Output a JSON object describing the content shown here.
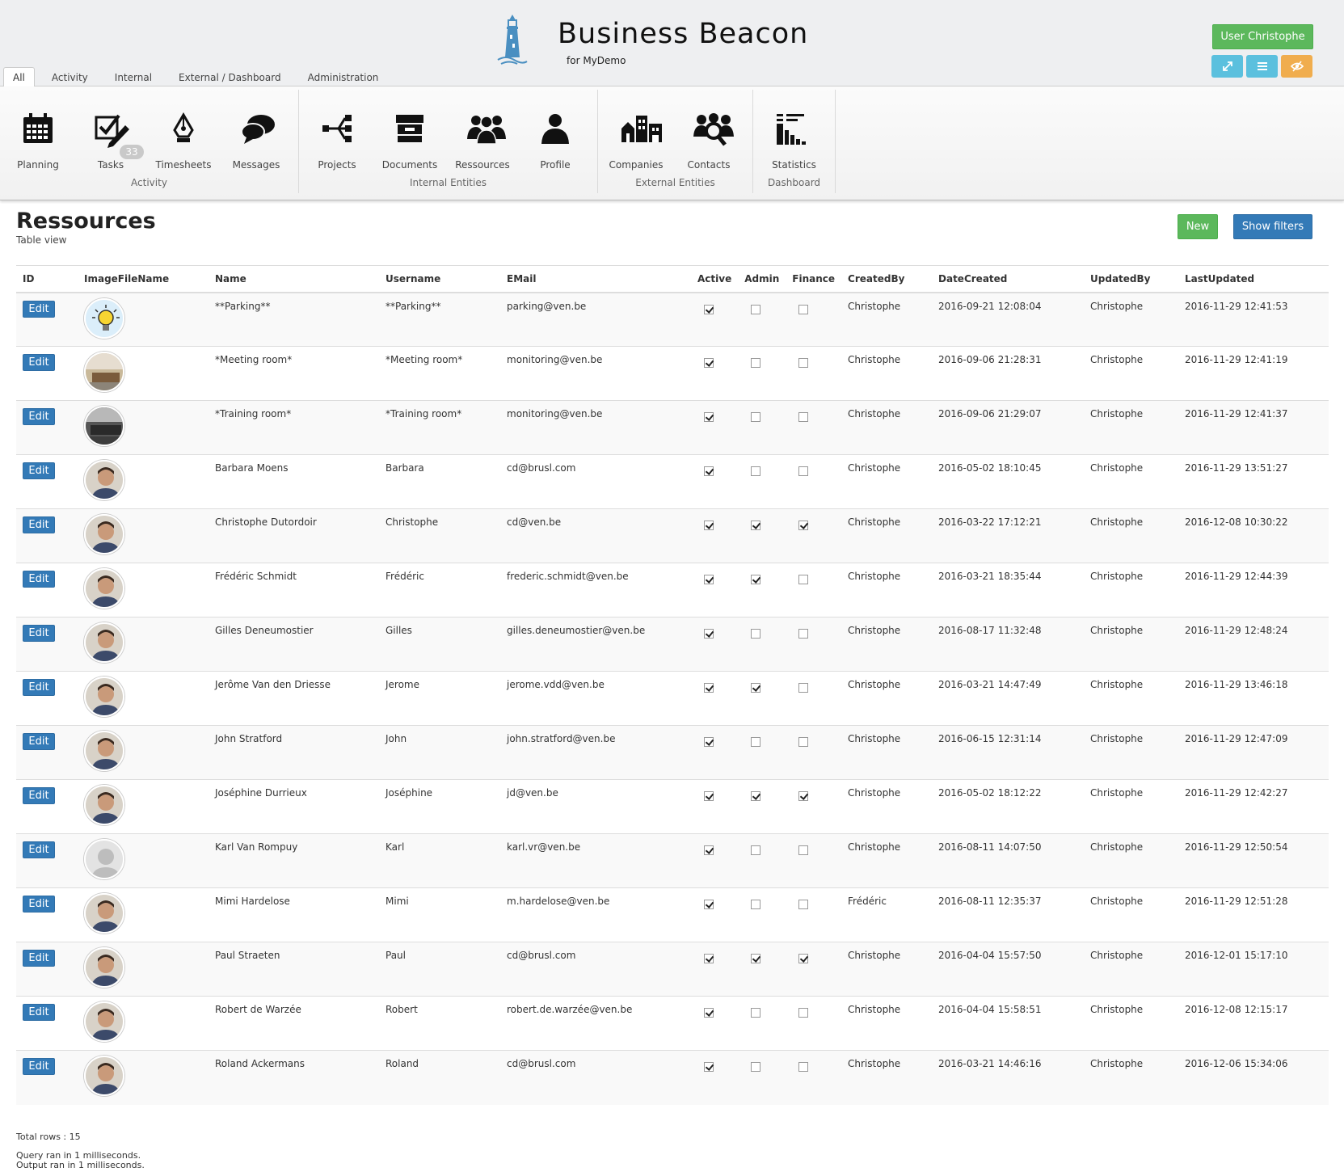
{
  "header": {
    "title": "Business Beacon",
    "subtitle": "for MyDemo",
    "user_button": "User Christophe",
    "tabs": [
      "All",
      "Activity",
      "Internal",
      "External / Dashboard",
      "Administration"
    ]
  },
  "ribbon": {
    "groups": [
      {
        "label": "Activity",
        "items": [
          {
            "label": "Planning",
            "icon": "calendar-icon"
          },
          {
            "label": "Tasks",
            "icon": "tasks-icon",
            "badge": "33"
          },
          {
            "label": "Timesheets",
            "icon": "pen-nib-icon"
          },
          {
            "label": "Messages",
            "icon": "chat-bubbles-icon"
          }
        ]
      },
      {
        "label": "Internal Entities",
        "items": [
          {
            "label": "Projects",
            "icon": "share-tree-icon"
          },
          {
            "label": "Documents",
            "icon": "archive-box-icon"
          },
          {
            "label": "Ressources",
            "icon": "people-group-icon"
          },
          {
            "label": "Profile",
            "icon": "person-icon"
          }
        ]
      },
      {
        "label": "External Entities",
        "items": [
          {
            "label": "Companies",
            "icon": "buildings-icon"
          },
          {
            "label": "Contacts",
            "icon": "people-search-icon"
          }
        ]
      },
      {
        "label": "Dashboard",
        "items": [
          {
            "label": "Statistics",
            "icon": "statistics-icon"
          }
        ]
      }
    ]
  },
  "page": {
    "title": "Ressources",
    "subtitle": "Table view",
    "new_button": "New",
    "filters_button": "Show filters"
  },
  "table": {
    "columns": [
      "ID",
      "ImageFileName",
      "Name",
      "Username",
      "EMail",
      "Active",
      "Admin",
      "Finance",
      "CreatedBy",
      "DateCreated",
      "UpdatedBy",
      "LastUpdated"
    ],
    "edit_label": "Edit",
    "rows": [
      {
        "name": "**Parking**",
        "username": "**Parking**",
        "email": "parking@ven.be",
        "active": true,
        "admin": false,
        "finance": false,
        "created_by": "Christophe",
        "date_created": "2016-09-21 12:08:04",
        "updated_by": "Christophe",
        "last_updated": "2016-11-29 12:41:53",
        "avatar": "lightbulb"
      },
      {
        "name": "*Meeting room*",
        "username": "*Meeting room*",
        "email": "monitoring@ven.be",
        "active": true,
        "admin": false,
        "finance": false,
        "created_by": "Christophe",
        "date_created": "2016-09-06 21:28:31",
        "updated_by": "Christophe",
        "last_updated": "2016-11-29 12:41:19",
        "avatar": "room"
      },
      {
        "name": "*Training room*",
        "username": "*Training room*",
        "email": "monitoring@ven.be",
        "active": true,
        "admin": false,
        "finance": false,
        "created_by": "Christophe",
        "date_created": "2016-09-06 21:29:07",
        "updated_by": "Christophe",
        "last_updated": "2016-11-29 12:41:37",
        "avatar": "room-dark"
      },
      {
        "name": "Barbara Moens",
        "username": "Barbara",
        "email": "cd@brusl.com",
        "active": true,
        "admin": false,
        "finance": false,
        "created_by": "Christophe",
        "date_created": "2016-05-02 18:10:45",
        "updated_by": "Christophe",
        "last_updated": "2016-11-29 13:51:27",
        "avatar": "person"
      },
      {
        "name": "Christophe Dutordoir",
        "username": "Christophe",
        "email": "cd@ven.be",
        "active": true,
        "admin": true,
        "finance": true,
        "created_by": "Christophe",
        "date_created": "2016-03-22 17:12:21",
        "updated_by": "Christophe",
        "last_updated": "2016-12-08 10:30:22",
        "avatar": "person"
      },
      {
        "name": "Frédéric Schmidt",
        "username": "Frédéric",
        "email": "frederic.schmidt@ven.be",
        "active": true,
        "admin": true,
        "finance": false,
        "created_by": "Christophe",
        "date_created": "2016-03-21 18:35:44",
        "updated_by": "Christophe",
        "last_updated": "2016-11-29 12:44:39",
        "avatar": "person"
      },
      {
        "name": "Gilles Deneumostier",
        "username": "Gilles",
        "email": "gilles.deneumostier@ven.be",
        "active": true,
        "admin": false,
        "finance": false,
        "created_by": "Christophe",
        "date_created": "2016-08-17 11:32:48",
        "updated_by": "Christophe",
        "last_updated": "2016-11-29 12:48:24",
        "avatar": "person"
      },
      {
        "name": "Jerôme Van den Driesse",
        "username": "Jerome",
        "email": "jerome.vdd@ven.be",
        "active": true,
        "admin": true,
        "finance": false,
        "created_by": "Christophe",
        "date_created": "2016-03-21 14:47:49",
        "updated_by": "Christophe",
        "last_updated": "2016-11-29 13:46:18",
        "avatar": "person"
      },
      {
        "name": "John Stratford",
        "username": "John",
        "email": "john.stratford@ven.be",
        "active": true,
        "admin": false,
        "finance": false,
        "created_by": "Christophe",
        "date_created": "2016-06-15 12:31:14",
        "updated_by": "Christophe",
        "last_updated": "2016-11-29 12:47:09",
        "avatar": "person"
      },
      {
        "name": "Joséphine Durrieux",
        "username": "Joséphine",
        "email": "jd@ven.be",
        "active": true,
        "admin": true,
        "finance": true,
        "created_by": "Christophe",
        "date_created": "2016-05-02 18:12:22",
        "updated_by": "Christophe",
        "last_updated": "2016-11-29 12:42:27",
        "avatar": "person"
      },
      {
        "name": "Karl Van Rompuy",
        "username": "Karl",
        "email": "karl.vr@ven.be",
        "active": true,
        "admin": false,
        "finance": false,
        "created_by": "Christophe",
        "date_created": "2016-08-11 14:07:50",
        "updated_by": "Christophe",
        "last_updated": "2016-11-29 12:50:54",
        "avatar": "placeholder"
      },
      {
        "name": "Mimi Hardelose",
        "username": "Mimi",
        "email": "m.hardelose@ven.be",
        "active": true,
        "admin": false,
        "finance": false,
        "created_by": "Frédéric",
        "date_created": "2016-08-11 12:35:37",
        "updated_by": "Christophe",
        "last_updated": "2016-11-29 12:51:28",
        "avatar": "person"
      },
      {
        "name": "Paul Straeten",
        "username": "Paul",
        "email": "cd@brusl.com",
        "active": true,
        "admin": true,
        "finance": true,
        "created_by": "Christophe",
        "date_created": "2016-04-04 15:57:50",
        "updated_by": "Christophe",
        "last_updated": "2016-12-01 15:17:10",
        "avatar": "person"
      },
      {
        "name": "Robert de Warzée",
        "username": "Robert",
        "email": "robert.de.warzée@ven.be",
        "active": true,
        "admin": false,
        "finance": false,
        "created_by": "Christophe",
        "date_created": "2016-04-04 15:58:51",
        "updated_by": "Christophe",
        "last_updated": "2016-12-08 12:15:17",
        "avatar": "person"
      },
      {
        "name": "Roland Ackermans",
        "username": "Roland",
        "email": "cd@brusl.com",
        "active": true,
        "admin": false,
        "finance": false,
        "created_by": "Christophe",
        "date_created": "2016-03-21 14:46:16",
        "updated_by": "Christophe",
        "last_updated": "2016-12-06 15:34:06",
        "avatar": "person"
      }
    ]
  },
  "footer": {
    "total_rows": "Total rows : 15",
    "query_time": "Query ran in 1 milliseconds.",
    "output_time": "Output ran in 1 milliseconds."
  },
  "colors": {
    "primary": "#337ab7",
    "success": "#5cb85c",
    "info": "#5bc0de",
    "warning": "#f0ad4e",
    "logo": "#4a8fc1"
  }
}
